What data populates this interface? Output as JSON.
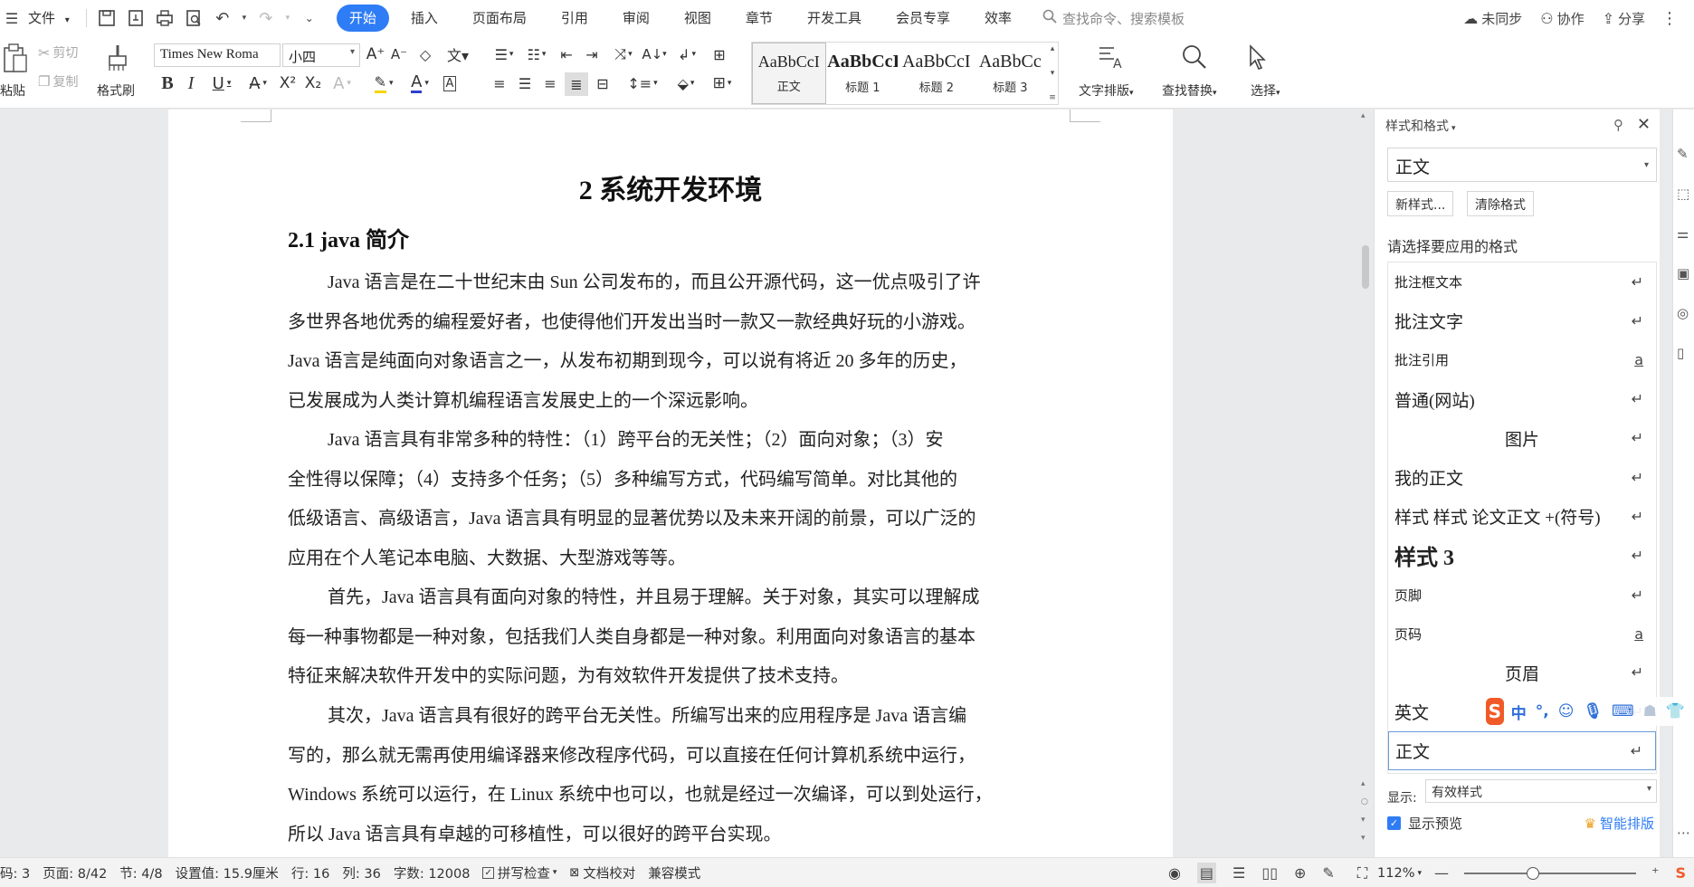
{
  "menubar": {
    "file_label": "文件",
    "tabs": [
      "开始",
      "插入",
      "页面布局",
      "引用",
      "审阅",
      "视图",
      "章节",
      "开发工具",
      "会员专享",
      "效率"
    ],
    "active_tab": "开始",
    "search_placeholder": "查找命令、搜索模板",
    "sync_label": "未同步",
    "collab_label": "协作",
    "share_label": "分享"
  },
  "ribbon": {
    "paste_label": "粘贴",
    "cut_label": "剪切",
    "copy_label": "复制",
    "format_painter_label": "格式刷",
    "font_name": "Times New Roma",
    "font_size": "小四",
    "styles": [
      {
        "sample": "AaBbCcI",
        "name": "正文",
        "bold": false
      },
      {
        "sample": "AaBbCcI",
        "name": "标题 1",
        "bold": true
      },
      {
        "sample": "AaBbCcI",
        "name": "标题 2",
        "bold": true
      },
      {
        "sample": "AaBbCc",
        "name": "标题 3",
        "bold": true
      }
    ],
    "text_layout_label": "文字排版",
    "find_replace_label": "查找替换",
    "select_label": "选择"
  },
  "document": {
    "title": "2  系统开发环境",
    "heading": "2.1 java 简介",
    "paragraphs": [
      {
        "lines": [
          "Java 语言是在二十世纪末由 Sun 公司发布的，而且公开源代码，这一优点吸引了许",
          "多世界各地优秀的编程爱好者，也使得他们开发出当时一款又一款经典好玩的小游戏。",
          "Java 语言是纯面向对象语言之一，从发布初期到现今，可以说有将近 20 多年的历史，",
          "已发展成为人类计算机编程语言发展史上的一个深远影响。"
        ]
      },
      {
        "lines": [
          "Java 语言具有非常多种的特性：（1）跨平台的无关性；（2）面向对象；（3）安",
          "全性得以保障；（4）支持多个任务；（5）多种编写方式，代码编写简单。对比其他的",
          "低级语言、高级语言，Java 语言具有明显的显著优势以及未来开阔的前景，可以广泛的",
          "应用在个人笔记本电脑、大数据、大型游戏等等。"
        ]
      },
      {
        "lines": [
          "首先，Java 语言具有面向对象的特性，并且易于理解。关于对象，其实可以理解成",
          "每一种事物都是一种对象，包括我们人类自身都是一种对象。利用面向对象语言的基本",
          "特征来解决软件开发中的实际问题，为有效软件开发提供了技术支持。"
        ]
      },
      {
        "lines": [
          "其次，Java 语言具有很好的跨平台无关性。所编写出来的应用程序是 Java 语言编",
          "写的，那么就无需再使用编译器来修改程序代码，可以直接在任何计算机系统中运行，",
          "Windows 系统可以运行，在 Linux 系统中也可以，也就是经过一次编译，可以到处运行，",
          "所以 Java 语言具有卓越的可移植性，可以很好的跨平台实现。"
        ]
      }
    ]
  },
  "styles_pane": {
    "title": "样式和格式",
    "current_style": "正文",
    "new_style_label": "新样式...",
    "clear_format_label": "清除格式",
    "prompt": "请选择要应用的格式",
    "items": [
      {
        "name": "批注框文本",
        "mark": "↵",
        "kind": "sans"
      },
      {
        "name": "批注文字",
        "mark": "↵",
        "kind": "serif"
      },
      {
        "name": "批注引用",
        "mark": "a",
        "kind": "sans"
      },
      {
        "name": "普通(网站)",
        "mark": "↵",
        "kind": "serif"
      },
      {
        "name": "图片",
        "mark": "↵",
        "kind": "center"
      },
      {
        "name": "我的正文",
        "mark": "↵",
        "kind": "serif"
      },
      {
        "name": "样式 样式 论文正文 +(符号)",
        "mark": "↵",
        "kind": "serif"
      },
      {
        "name": "样式 3",
        "mark": "↵",
        "kind": "big"
      },
      {
        "name": "页脚",
        "mark": "↵",
        "kind": "sans"
      },
      {
        "name": "页码",
        "mark": "a",
        "kind": "sans"
      },
      {
        "name": "页眉",
        "mark": "↵",
        "kind": "center"
      },
      {
        "name": "英文",
        "mark": "↵",
        "kind": "serif"
      },
      {
        "name": "正文",
        "mark": "↵",
        "kind": "serif",
        "selected": true
      }
    ],
    "show_label": "显示:",
    "show_value": "有效样式",
    "preview_label": "显示预览",
    "smart_layout_label": "智能排版"
  },
  "statusbar": {
    "page_code": "码: 3",
    "page": "页面: 8/42",
    "section": "节: 4/8",
    "setting": "设置值: 15.9厘米",
    "row": "行: 16",
    "col": "列: 36",
    "word_count": "字数: 12008",
    "spell_check": "拼写检查",
    "doc_proof": "文档校对",
    "compat_mode": "兼容模式",
    "zoom": "112%",
    "zoom_fraction": 0.39
  },
  "accent_color": "#2e7cf6"
}
